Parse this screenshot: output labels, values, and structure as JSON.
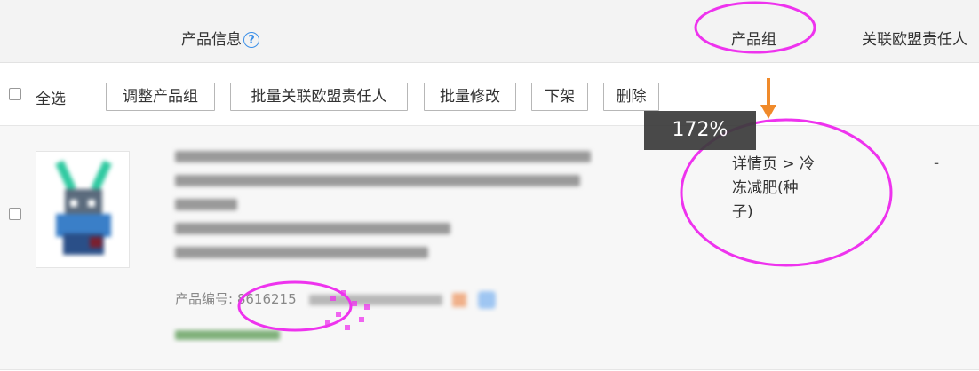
{
  "header": {
    "product_info_label": "产品信息",
    "product_group_label": "产品组",
    "eu_responsible_label": "关联欧盟责任人"
  },
  "toolbar": {
    "select_all_label": "全选",
    "buttons": [
      "调整产品组",
      "批量关联欧盟责任人",
      "批量修改",
      "下架",
      "删除"
    ]
  },
  "product": {
    "code_label": "产品编号:",
    "code_value": "8616215",
    "group_path": [
      "详情页 > 冷",
      "冻减肥(种",
      "子)"
    ],
    "eu_responsible": "-"
  },
  "overlay": {
    "zoom_level": "172%"
  },
  "colors": {
    "annotation_magenta": "#ee33ee",
    "arrow_orange": "#f08a2a",
    "help_blue": "#3b8fe8"
  }
}
